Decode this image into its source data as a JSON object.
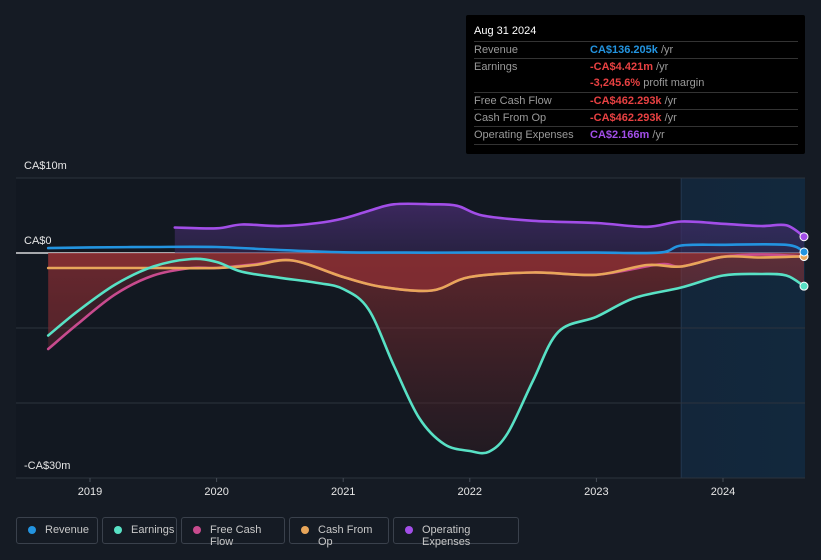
{
  "tooltip": {
    "date": "Aug 31 2024",
    "rows": [
      {
        "label": "Revenue",
        "value": "CA$136.205k",
        "unit": " /yr",
        "color": "#2394e0"
      },
      {
        "label": "Earnings",
        "value": "-CA$4.421m",
        "unit": " /yr",
        "color": "#e84142"
      },
      {
        "label": "",
        "value": "-3,245.6%",
        "unit": " profit margin",
        "color": "#e84142"
      },
      {
        "label": "Free Cash Flow",
        "value": "-CA$462.293k",
        "unit": " /yr",
        "color": "#e84142"
      },
      {
        "label": "Cash From Op",
        "value": "-CA$462.293k",
        "unit": " /yr",
        "color": "#e84142"
      },
      {
        "label": "Operating Expenses",
        "value": "CA$2.166m",
        "unit": " /yr",
        "color": "#a24ee8"
      }
    ]
  },
  "chart_data": {
    "type": "line",
    "title": "",
    "xlabel": "",
    "ylabel": "",
    "y_tick_labels": [
      "CA$10m",
      "CA$0",
      "-CA$30m"
    ],
    "ylim": [
      -30,
      10
    ],
    "y_unit": "CA$ millions",
    "x_tick_labels": [
      "2019",
      "2020",
      "2021",
      "2022",
      "2023",
      "2024"
    ],
    "xlim": [
      2018.0,
      2024.9
    ],
    "highlight_from": 2023.67,
    "grid": true,
    "legend_position": "bottom",
    "series": [
      {
        "name": "Revenue",
        "color": "#2394e0",
        "x": [
          2018.67,
          2019.0,
          2019.5,
          2020.0,
          2020.5,
          2021.0,
          2021.5,
          2022.0,
          2022.5,
          2023.0,
          2023.5,
          2023.67,
          2024.0,
          2024.5,
          2024.67
        ],
        "y": [
          0.65,
          0.75,
          0.8,
          0.8,
          0.4,
          0.1,
          0.05,
          0.05,
          0.05,
          0.05,
          0.05,
          1.0,
          1.1,
          1.1,
          0.14
        ]
      },
      {
        "name": "Earnings",
        "color": "#58e1c5",
        "x": [
          2018.67,
          2018.9,
          2019.2,
          2019.5,
          2019.8,
          2020.0,
          2020.2,
          2020.5,
          2020.8,
          2021.0,
          2021.2,
          2021.4,
          2021.6,
          2021.8,
          2022.0,
          2022.15,
          2022.3,
          2022.5,
          2022.7,
          2023.0,
          2023.3,
          2023.67,
          2024.0,
          2024.3,
          2024.5,
          2024.67
        ],
        "y": [
          -11.0,
          -7.8,
          -4.2,
          -1.8,
          -0.8,
          -1.2,
          -2.5,
          -3.3,
          -4.0,
          -4.8,
          -7.5,
          -15.0,
          -22.0,
          -25.5,
          -26.4,
          -26.5,
          -24.0,
          -17.0,
          -10.5,
          -8.5,
          -6.0,
          -4.6,
          -3.0,
          -2.8,
          -3.0,
          -4.42
        ]
      },
      {
        "name": "Free Cash Flow",
        "color": "#c84b8e",
        "x": [
          2018.67,
          2018.9,
          2019.2,
          2019.5,
          2019.8,
          2020.0,
          2020.3,
          2020.6,
          2021.0,
          2021.3,
          2021.7,
          2022.0,
          2022.5,
          2023.0,
          2023.5,
          2023.67,
          2024.0,
          2024.3,
          2024.67
        ],
        "y": [
          -12.8,
          -9.5,
          -5.5,
          -3.0,
          -2.0,
          -2.0,
          -1.5,
          -1.0,
          -3.2,
          -4.5,
          -5.0,
          -3.2,
          -2.6,
          -2.9,
          -1.5,
          -1.8,
          -0.5,
          -0.2,
          -0.46
        ]
      },
      {
        "name": "Cash From Op",
        "color": "#e8a65a",
        "x": [
          2018.67,
          2019.0,
          2019.5,
          2020.0,
          2020.3,
          2020.6,
          2021.0,
          2021.3,
          2021.7,
          2022.0,
          2022.5,
          2023.0,
          2023.4,
          2023.67,
          2024.0,
          2024.3,
          2024.67
        ],
        "y": [
          -2.0,
          -2.0,
          -2.0,
          -2.0,
          -1.6,
          -1.0,
          -3.2,
          -4.5,
          -5.0,
          -3.2,
          -2.6,
          -2.9,
          -1.6,
          -1.8,
          -0.5,
          -0.6,
          -0.46
        ]
      },
      {
        "name": "Operating Expenses",
        "color": "#a24ee8",
        "x": [
          2019.67,
          2020.0,
          2020.2,
          2020.5,
          2020.8,
          2021.0,
          2021.2,
          2021.4,
          2021.7,
          2021.9,
          2022.1,
          2022.5,
          2023.0,
          2023.4,
          2023.67,
          2024.0,
          2024.3,
          2024.5,
          2024.67
        ],
        "y": [
          3.4,
          3.3,
          3.8,
          3.6,
          4.0,
          4.6,
          5.6,
          6.5,
          6.5,
          6.3,
          5.0,
          4.3,
          4.0,
          3.5,
          4.2,
          3.9,
          3.6,
          3.7,
          2.17
        ]
      }
    ]
  },
  "legend": [
    {
      "label": "Revenue",
      "color": "#2394e0"
    },
    {
      "label": "Earnings",
      "color": "#58e1c5"
    },
    {
      "label": "Free Cash Flow",
      "color": "#c84b8e"
    },
    {
      "label": "Cash From Op",
      "color": "#e8a65a"
    },
    {
      "label": "Operating Expenses",
      "color": "#a24ee8"
    }
  ]
}
